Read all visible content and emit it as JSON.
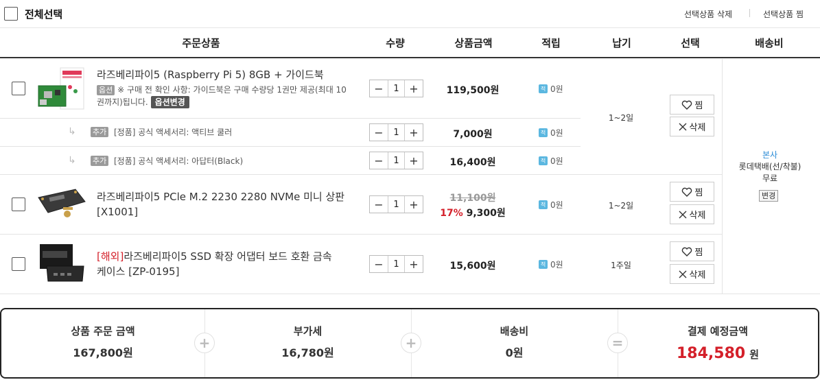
{
  "top": {
    "select_all": "전체선택",
    "delete_selected": "선택상품 삭제",
    "wish_selected": "선택상품 찜"
  },
  "headers": {
    "product": "주문상품",
    "qty": "수량",
    "amount": "상품금액",
    "points": "적립",
    "lead": "납기",
    "select": "선택",
    "shipping": "배송비"
  },
  "items": [
    {
      "name": "라즈베리파이5 (Raspberry Pi 5) 8GB + 가이드북",
      "option_badge": "옵션",
      "option_note_1": "※ 구매 전 확인 사항: 가이드북은 구매 수량당 1권만 제공(최대 10",
      "option_note_2": "권까지)됩니다.",
      "option_change": "옵션변경",
      "qty": "1",
      "price": "119,500원",
      "points": "0원",
      "lead": "1~2일"
    },
    {
      "name_line1": "라즈베리파이5 PCle M.2 2230 2280 NVMe 미니 상판",
      "name_line2": "[X1001]",
      "qty": "1",
      "original_price": "11,100원",
      "discount": "17%",
      "price": "9,300원",
      "points": "0원",
      "lead": "1~2일"
    },
    {
      "prefix": "[해외]",
      "name_line1": "라즈베리파이5 SSD 확장 어댑터 보드 호환 금속",
      "name_line2": "케이스 [ZP-0195]",
      "qty": "1",
      "price": "15,600원",
      "points": "0원",
      "lead": "1주일"
    }
  ],
  "addons": [
    {
      "badge": "추가",
      "text": "[정품] 공식 액세서리: 액티브 쿨러",
      "qty": "1",
      "price": "7,000원",
      "points": "0원"
    },
    {
      "badge": "추가",
      "text": "[정품] 공식 액세서리: 아답터(Black)",
      "qty": "1",
      "price": "16,400원",
      "points": "0원"
    }
  ],
  "actions": {
    "wish": "찜",
    "delete": "삭제"
  },
  "point_icon": "적",
  "shipping": {
    "origin": "본사",
    "method": "롯데택배(선/착불)",
    "fee": "무료",
    "change": "변경"
  },
  "summary": {
    "order_label": "상품 주문 금액",
    "order_value": "167,800원",
    "vat_label": "부가세",
    "vat_value": "16,780원",
    "ship_label": "배송비",
    "ship_value": "0원",
    "total_label": "결제 예정금액",
    "total_value": "184,580",
    "total_unit": "원"
  },
  "colors": {
    "accent_red": "#d4202a",
    "point_blue": "#5bb7e0",
    "link_blue": "#2a8bd6"
  }
}
